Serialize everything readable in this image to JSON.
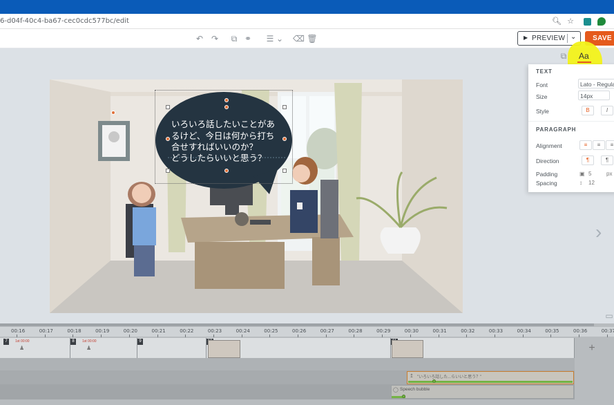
{
  "browser": {
    "url": "6-d04f-40c4-ba67-cec0cdc577bc/edit",
    "icons": [
      "zoom-icon",
      "star-icon",
      "extension-icon",
      "evernote-icon",
      "menu-icon"
    ]
  },
  "toolbar": {
    "preview_label": "PREVIEW",
    "save_label": "SAVE",
    "font_panel_label": "Aa"
  },
  "scene": {
    "speech_text": "いろいろ話したいことがあ\nるけど、今日は何から打ち\n合せすればいいのか？\nどうしたらいいと思う？"
  },
  "properties": {
    "text_section": "TEXT",
    "font_label": "Font",
    "font_value": "Lato - Regular",
    "size_label": "Size",
    "size_value": "14px",
    "style_label": "Style",
    "bold_label": "B",
    "italic_label": "I",
    "paragraph_section": "PARAGRAPH",
    "alignment_label": "Alignment",
    "direction_label": "Direction",
    "padding_label": "Padding",
    "padding_value": "5",
    "padding_unit": "px",
    "spacing_label": "Spacing",
    "spacing_value": "12"
  },
  "timeline": {
    "ticks": [
      "00:16",
      "00:17",
      "00:18",
      "00:19",
      "00:20",
      "00:21",
      "00:22",
      "00:23",
      "00:24",
      "00:25",
      "00:26",
      "00:27",
      "00:28",
      "00:29",
      "00:30",
      "00:31",
      "00:32",
      "00:33",
      "00:34",
      "00:35",
      "00:36",
      "00:37"
    ],
    "scenes": [
      {
        "num": "7",
        "time": "1st 00:00"
      },
      {
        "num": "8",
        "time": "1st 00:00"
      },
      {
        "num": "9",
        "time": ""
      },
      {
        "num": "10",
        "time": ""
      },
      {
        "num": "11",
        "time": ""
      }
    ],
    "bubble_clip_label": "\"いろいろ話した...らいいと思う？\"",
    "layer_label": "Speech bubble",
    "add_label": "+"
  },
  "colors": {
    "accent": "#e55a1c",
    "os_bar": "#0a5bb8",
    "bubble": "#243441",
    "highlight": "#f2f21a",
    "clip_green": "#74b344"
  }
}
